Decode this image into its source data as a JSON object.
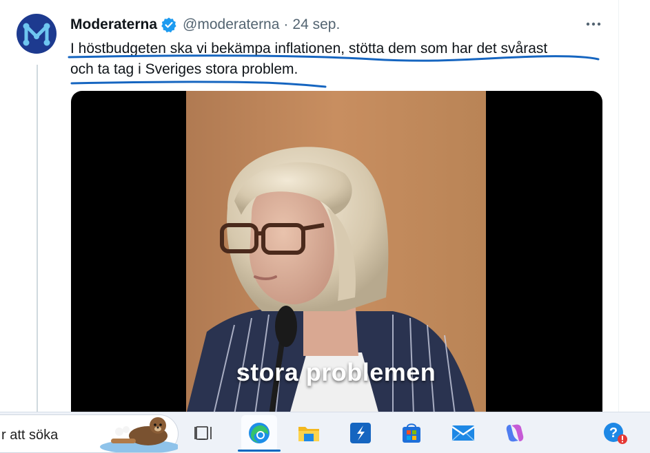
{
  "tweet": {
    "author_name": "Moderaterna",
    "handle": "@moderaterna",
    "separator": "·",
    "date": "24 sep.",
    "more_label": "•••",
    "text_line_1": "I höstbudgeten ska vi bekämpa inflationen, stötta dem som har det svårast",
    "text_line_2": "och ta tag i Sveriges stora problem.",
    "avatar_letter": "M"
  },
  "video": {
    "caption": "stora problemen"
  },
  "taskbar": {
    "search_text": "r att söka",
    "icons": [
      "task-view-icon",
      "edge-icon",
      "file-explorer-icon",
      "app-icon",
      "microsoft-store-icon",
      "mail-icon",
      "copilot-icon",
      "help-icon"
    ]
  },
  "colors": {
    "verified": "#1d9bf0",
    "underline": "#1565c0",
    "avatar_bg": "#1d3a8f",
    "handle_text": "#536471"
  }
}
